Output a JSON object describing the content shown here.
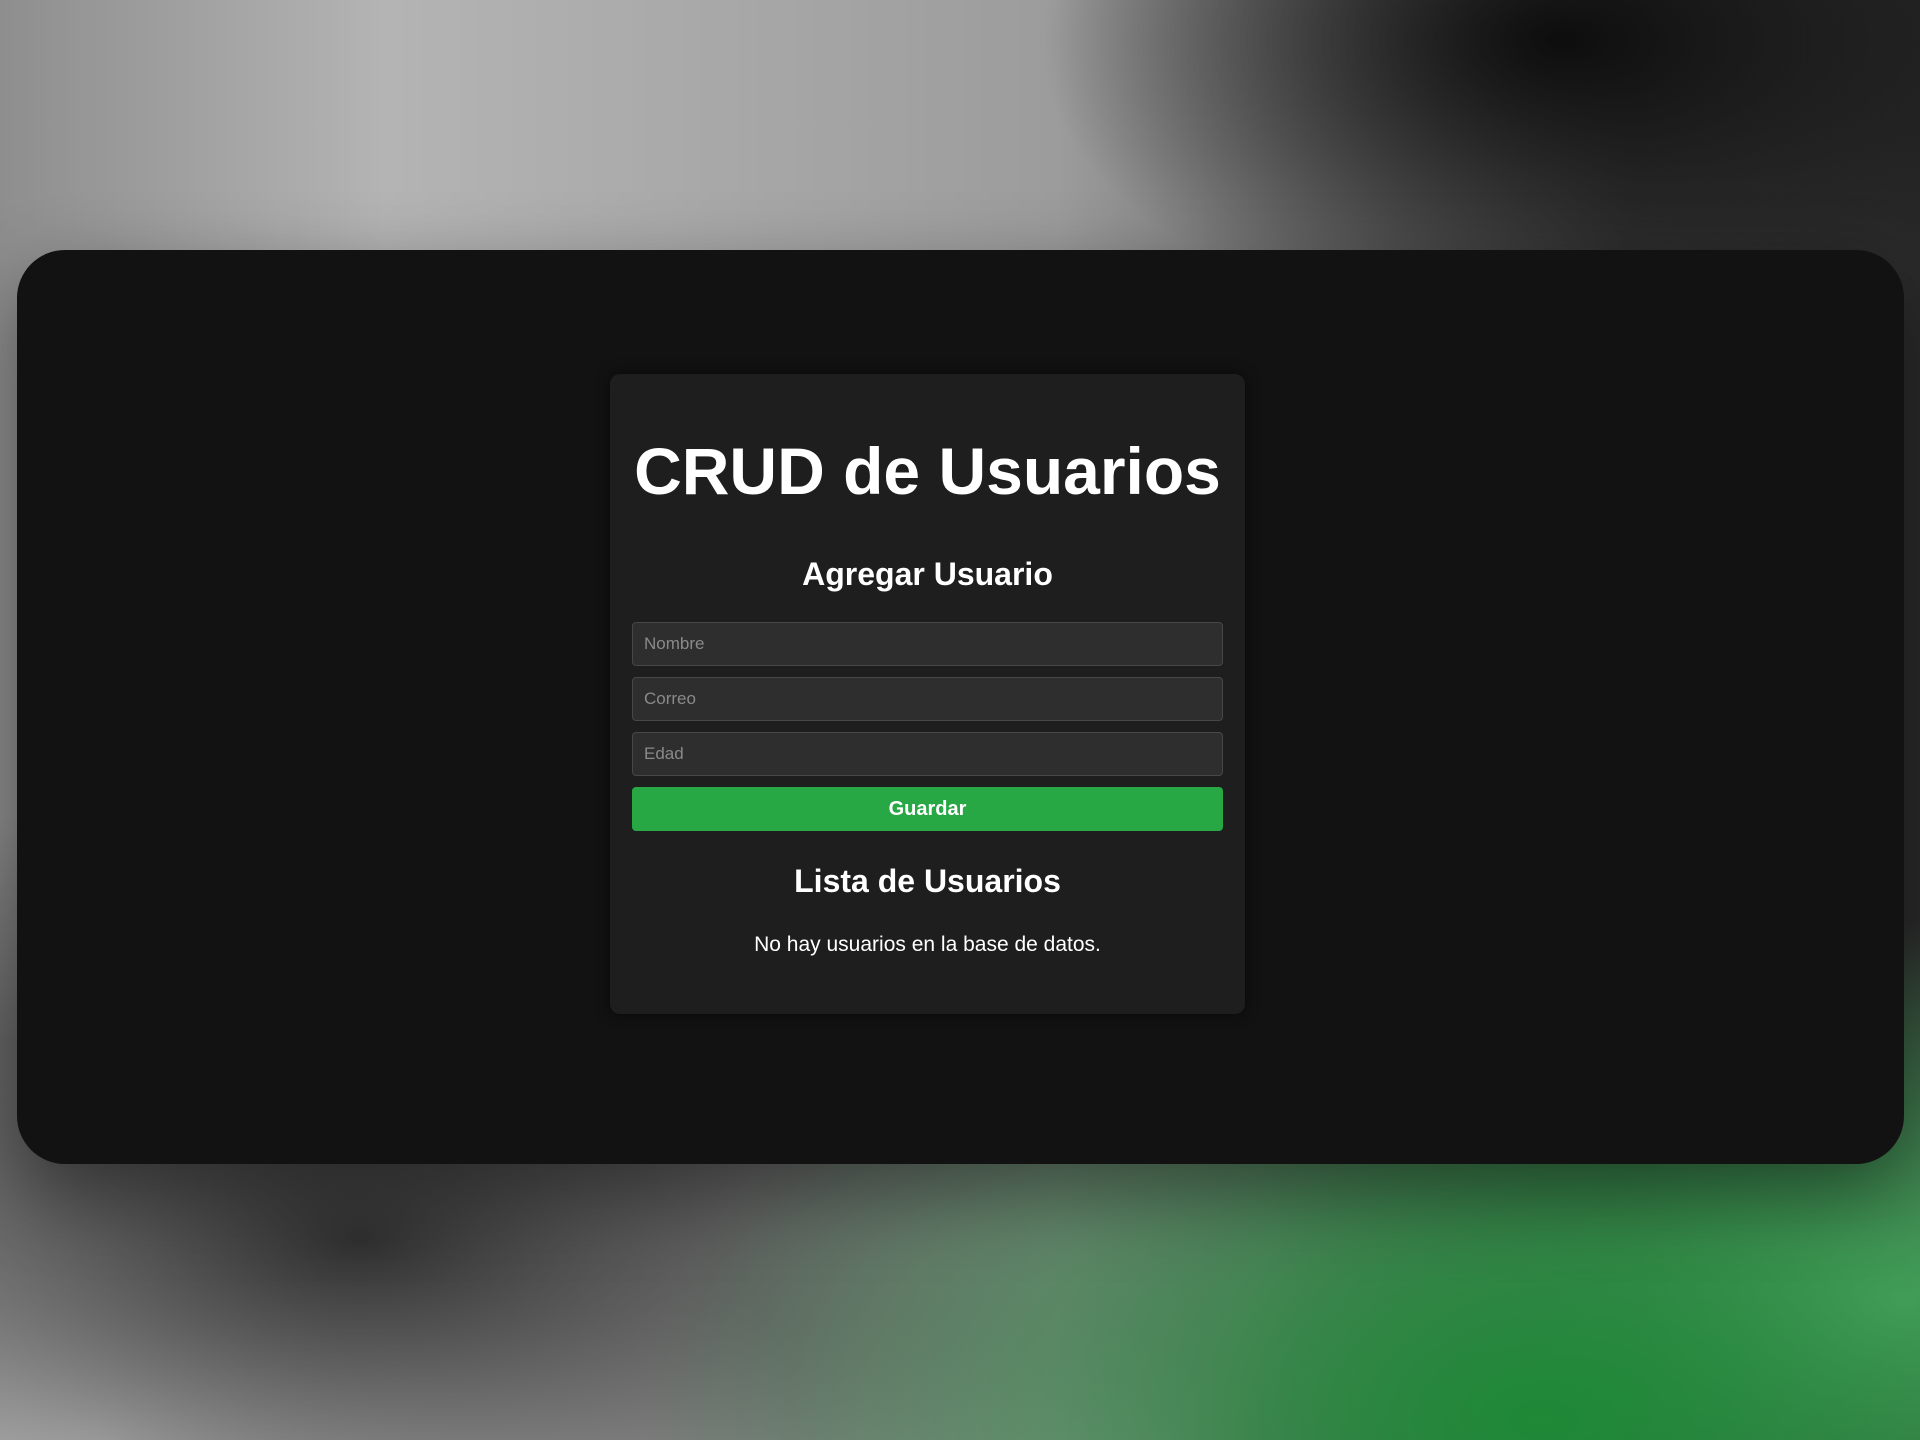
{
  "page": {
    "title": "CRUD de Usuarios"
  },
  "add_section": {
    "heading": "Agregar Usuario",
    "fields": {
      "nombre": {
        "placeholder": "Nombre",
        "value": ""
      },
      "correo": {
        "placeholder": "Correo",
        "value": ""
      },
      "edad": {
        "placeholder": "Edad",
        "value": ""
      }
    },
    "save_label": "Guardar"
  },
  "list_section": {
    "heading": "Lista de Usuarios",
    "empty_message": "No hay usuarios en la base de datos."
  },
  "colors": {
    "window_bg": "#121212",
    "card_bg": "#1e1e1e",
    "input_bg": "#2e2e2e",
    "accent": "#28a745",
    "text": "#ffffff",
    "placeholder": "#8a8a8a"
  }
}
